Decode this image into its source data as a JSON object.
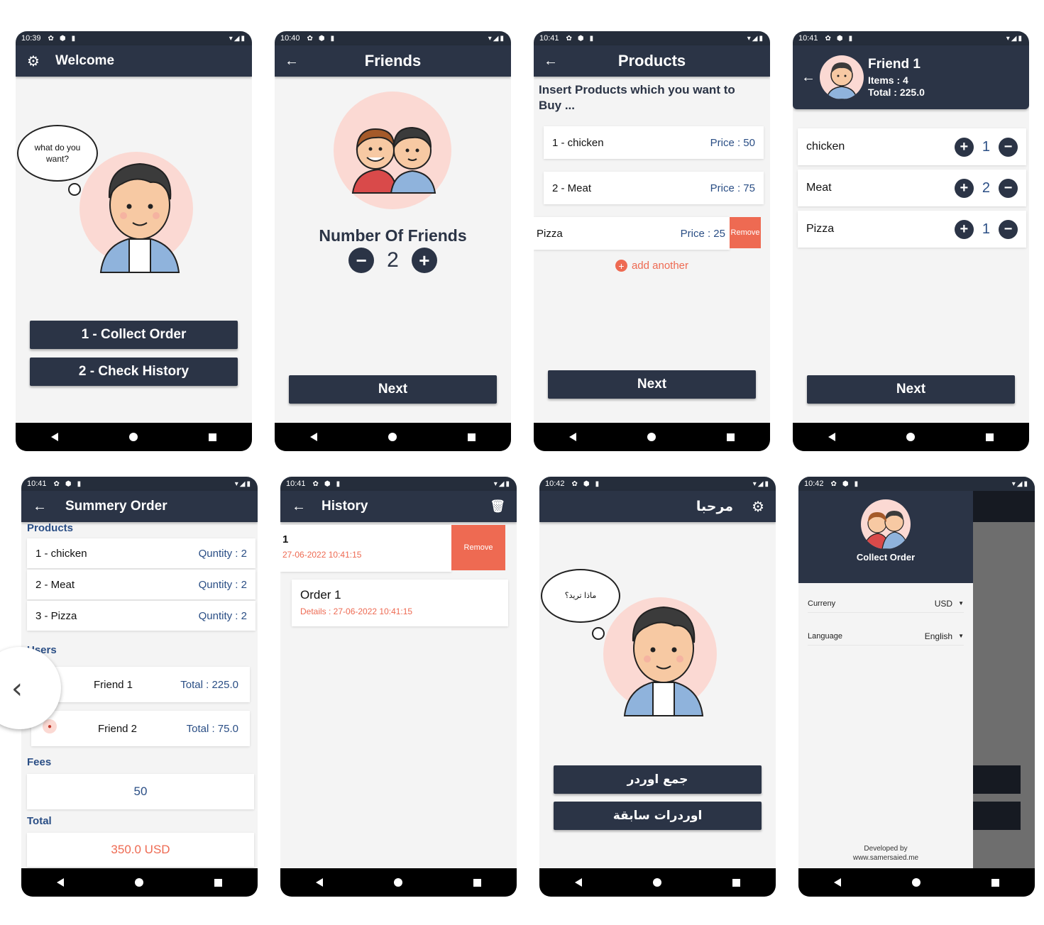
{
  "colors": {
    "primary": "#2b3446",
    "accent": "#ee6a52",
    "blue_text": "#2a4e85"
  },
  "screens": {
    "welcome": {
      "status_time": "10:39",
      "title": "Welcome",
      "thought": "what do you want?",
      "buttons": [
        "1 - Collect Order",
        "2 - Check History"
      ]
    },
    "friends": {
      "status_time": "10:40",
      "title": "Friends",
      "label": "Number Of Friends",
      "count": "2",
      "next": "Next"
    },
    "products": {
      "status_time": "10:41",
      "title": "Products",
      "subtitle": "Insert Products which you want to Buy ...",
      "items": [
        {
          "name": "1 - chicken",
          "price": "Price : 50"
        },
        {
          "name": "2 - Meat",
          "price": "Price : 75"
        }
      ],
      "swiped_item": {
        "name": "Pizza",
        "price": "Price : 25",
        "remove": "Remove"
      },
      "add_another": "add another",
      "next": "Next"
    },
    "friend_detail": {
      "status_time": "10:41",
      "name": "Friend 1",
      "items": "Items : 4",
      "total": "Total : 225.0",
      "rows": [
        {
          "name": "chicken",
          "qty": "1"
        },
        {
          "name": "Meat",
          "qty": "2"
        },
        {
          "name": "Pizza",
          "qty": "1"
        }
      ],
      "next": "Next"
    },
    "summary": {
      "status_time": "10:41",
      "title": "Summery Order",
      "products_label": "Products",
      "products": [
        {
          "name": "1 - chicken",
          "qty": "Quntity : 2"
        },
        {
          "name": "2 - Meat",
          "qty": "Quntity : 2"
        },
        {
          "name": "3 - Pizza",
          "qty": "Quntity : 2"
        }
      ],
      "users_label": "Users",
      "users": [
        {
          "name": "Friend 1",
          "total": "Total : 225.0"
        },
        {
          "name": "Friend 2",
          "total": "Total : 75.0"
        }
      ],
      "fees_label": "Fees",
      "fees": "50",
      "total_label": "Total",
      "total": "350.0 USD"
    },
    "history": {
      "status_time": "10:41",
      "title": "History",
      "swiped": {
        "id": "1",
        "date": "27-06-2022 10:41:15",
        "remove": "Remove"
      },
      "order": {
        "title": "Order 1",
        "details": "Details : 27-06-2022 10:41:15"
      }
    },
    "arabic": {
      "status_time": "10:42",
      "title": "مرحبا",
      "thought": "ماذا تريد؟",
      "buttons": [
        "جمع اوردر",
        "اوردرات سابقة"
      ]
    },
    "drawer": {
      "status_time": "10:42",
      "header": "Collect Order",
      "currency_label": "Curreny",
      "currency_value": "USD",
      "language_label": "Language",
      "language_value": "English",
      "footer_1": "Developed by",
      "footer_2": "www.samersaied.me"
    }
  }
}
